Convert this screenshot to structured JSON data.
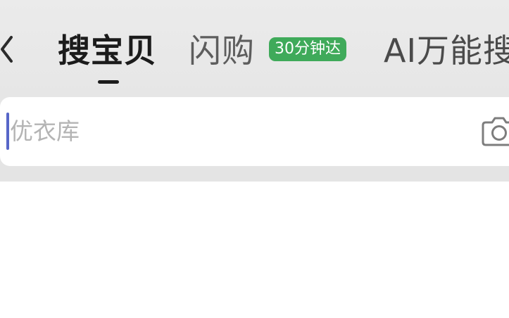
{
  "icons": {
    "back": "chevron-left-icon",
    "camera": "camera-icon"
  },
  "colors": {
    "badge_background": "#3faa5a",
    "caret": "#5766c8"
  },
  "tabs": [
    {
      "label": "搜宝贝",
      "active": true
    },
    {
      "label": "闪购",
      "active": false
    },
    {
      "label": "AI万能搜",
      "active": false
    }
  ],
  "delivery_badge": "30分钟达",
  "search": {
    "placeholder": "优衣库"
  }
}
